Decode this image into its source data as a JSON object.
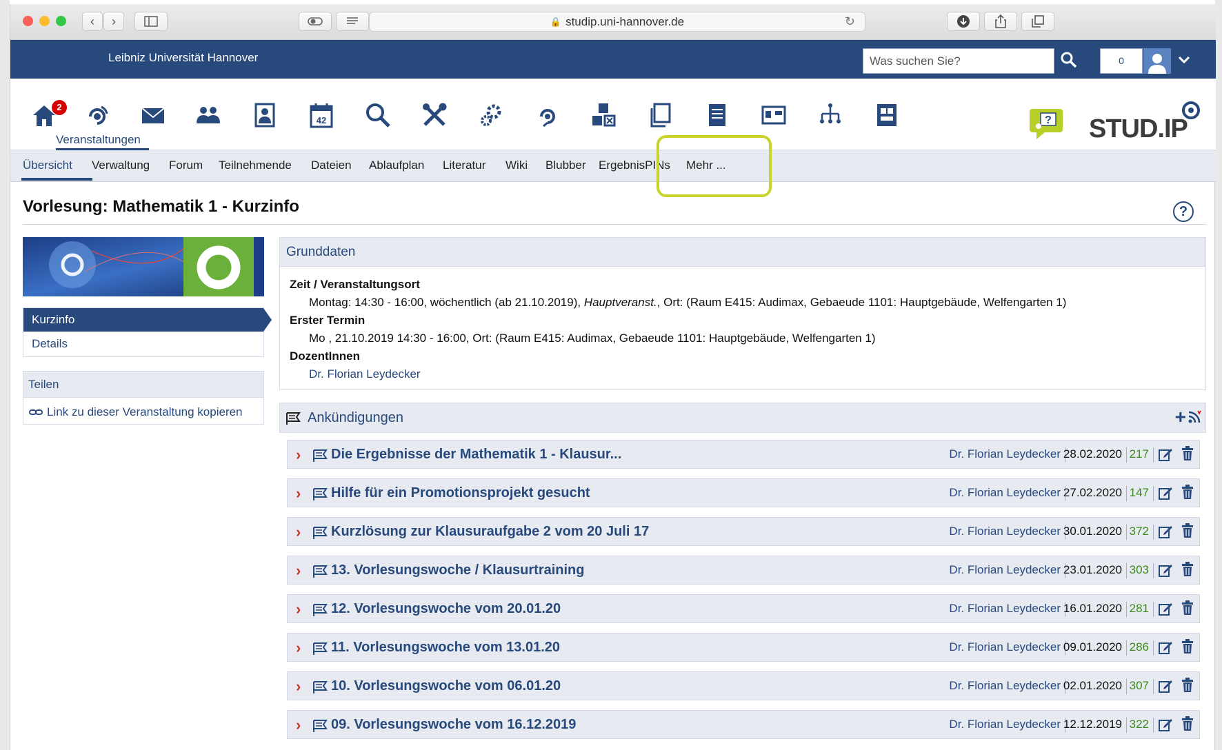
{
  "browser": {
    "url": "studip.uni-hannover.de"
  },
  "topbar": {
    "university": "Leibniz Universität Hannover",
    "search_placeholder": "Was suchen Sie?",
    "notification_count": "0"
  },
  "iconnav": {
    "home_badge": "2",
    "active_label": "Veranstaltungen",
    "calendar_day": "42",
    "icons": [
      "home-icon",
      "courses-icon",
      "mail-icon",
      "community-icon",
      "profile-icon",
      "calendar-icon",
      "search-icon",
      "tools-icon",
      "admin-icon",
      "courses-second-icon",
      "modules-icon",
      "files-icon",
      "literature-icon",
      "wiki-icon",
      "hierarchy-icon",
      "grades-icon"
    ]
  },
  "tabs": [
    "Übersicht",
    "Verwaltung",
    "Forum",
    "Teilnehmende",
    "Dateien",
    "Ablaufplan",
    "Literatur",
    "Wiki",
    "Blubber",
    "ErgebnisPINs",
    "Mehr ..."
  ],
  "page": {
    "title": "Vorlesung: Mathematik 1 - Kurzinfo",
    "help": "?"
  },
  "sidebar": {
    "nav": [
      "Kurzinfo",
      "Details"
    ],
    "share_heading": "Teilen",
    "share_link": "Link zu dieser Veranstaltung kopieren"
  },
  "grunddaten": {
    "heading": "Grunddaten",
    "time_label": "Zeit / Veranstaltungsort",
    "time_value_prefix": "Montag: 14:30 - 16:00, wöchentlich (ab 21.10.2019), ",
    "time_value_italic": "Hauptveranst.",
    "time_value_suffix": ", Ort: (Raum E415: Audimax, Gebaeude 1101: Hauptgebäude, Welfengarten 1)",
    "first_label": "Erster Termin",
    "first_value": "Mo , 21.10.2019 14:30 - 16:00, Ort: (Raum E415: Audimax, Gebaeude 1101: Hauptgebäude, Welfengarten 1)",
    "lecturer_label": "DozentInnen",
    "lecturer": "Dr. Florian Leydecker"
  },
  "announcements": {
    "heading": "Ankündigungen",
    "items": [
      {
        "title": "Die Ergebnisse der Mathematik 1 - Klausur...",
        "author": "Dr. Florian Leydecker",
        "date": "28.02.2020",
        "views": "217"
      },
      {
        "title": "Hilfe für ein Promotionsprojekt gesucht",
        "author": "Dr. Florian Leydecker",
        "date": "27.02.2020",
        "views": "147"
      },
      {
        "title": "Kurzlösung zur Klausuraufgabe 2 vom 20 Juli 17",
        "author": "Dr. Florian Leydecker",
        "date": "30.01.2020",
        "views": "372"
      },
      {
        "title": "13. Vorlesungswoche / Klausurtraining",
        "author": "Dr. Florian Leydecker",
        "date": "23.01.2020",
        "views": "303"
      },
      {
        "title": "12. Vorlesungswoche vom 20.01.20",
        "author": "Dr. Florian Leydecker",
        "date": "16.01.2020",
        "views": "281"
      },
      {
        "title": "11. Vorlesungswoche vom 13.01.20",
        "author": "Dr. Florian Leydecker",
        "date": "09.01.2020",
        "views": "286"
      },
      {
        "title": "10. Vorlesungswoche vom 06.01.20",
        "author": "Dr. Florian Leydecker",
        "date": "02.01.2020",
        "views": "307"
      },
      {
        "title": "09. Vorlesungswoche vom 16.12.2019",
        "author": "Dr. Florian Leydecker",
        "date": "12.12.2019",
        "views": "322"
      }
    ]
  },
  "colors": {
    "brand_blue": "#28497c",
    "highlight": "#c8d42a",
    "views_green": "#3a8a1c",
    "chevron_red": "#c0392b"
  }
}
